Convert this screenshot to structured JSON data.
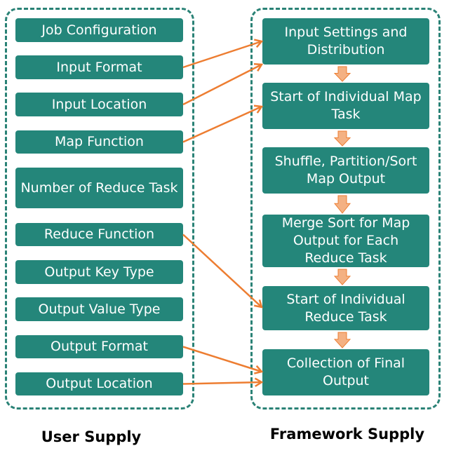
{
  "user_supply": {
    "label": "User Supply",
    "items": [
      "Job Configuration",
      "Input Format",
      "Input Location",
      "Map Function",
      "Number of Reduce Task",
      "Reduce Function",
      "Output Key Type",
      "Output Value Type",
      "Output Format",
      "Output Location"
    ]
  },
  "framework_supply": {
    "label": "Framework Supply",
    "steps": [
      "Input Settings and Distribution",
      "Start of Individual Map Task",
      "Shuffle, Partition/Sort Map Output",
      "Merge Sort for Map Output for Each Reduce Task",
      "Start of Individual Reduce Task",
      "Collection of Final Output"
    ]
  },
  "connections": [
    {
      "from": "Input Format",
      "to": "Input Settings and Distribution"
    },
    {
      "from": "Input Location",
      "to": "Input Settings and Distribution"
    },
    {
      "from": "Map Function",
      "to": "Start of Individual Map Task"
    },
    {
      "from": "Reduce Function",
      "to": "Start of Individual Reduce Task"
    },
    {
      "from": "Output Format",
      "to": "Collection of Final Output"
    },
    {
      "from": "Output Location",
      "to": "Collection of Final Output"
    }
  ],
  "colors": {
    "box": "#24867a",
    "border": "#2a8276",
    "connector": "#ed7d31",
    "flow_arrow_fill": "#f4b183"
  }
}
